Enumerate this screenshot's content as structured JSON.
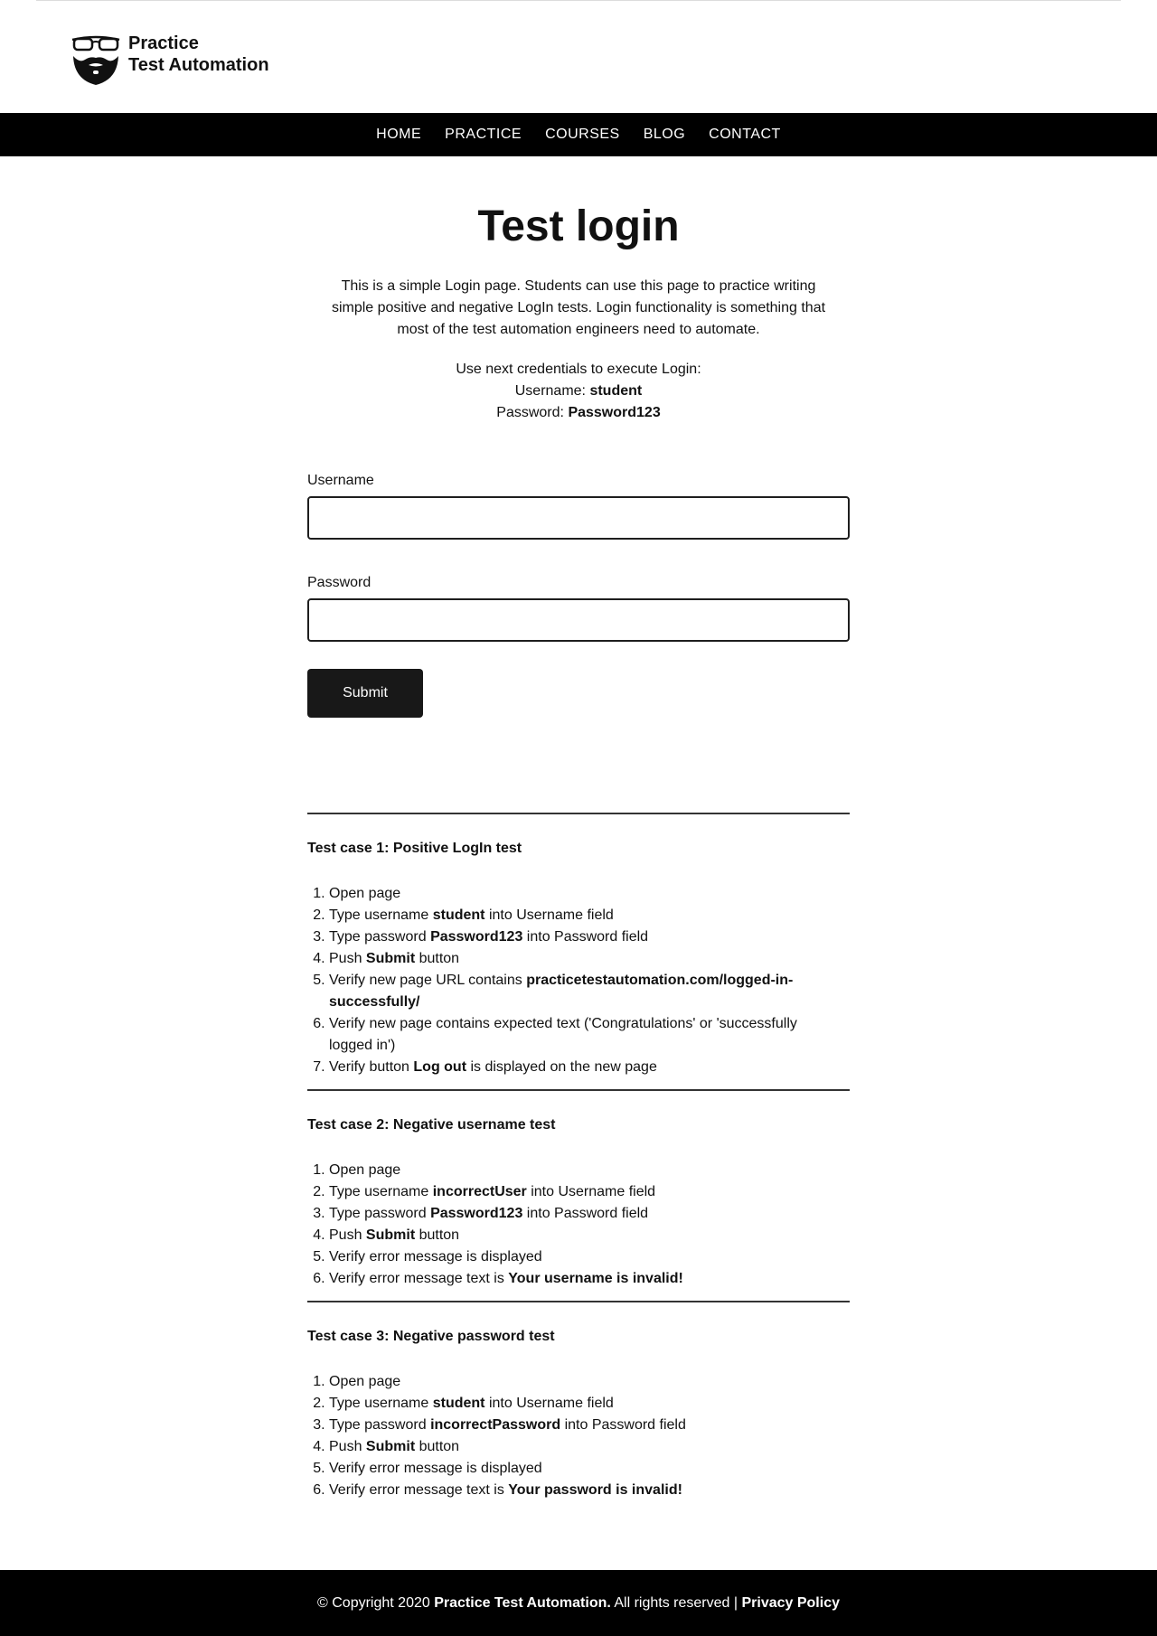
{
  "brand": {
    "line1": "Practice",
    "line2": "Test Automation",
    "icon": "bearded-glasses-face-icon"
  },
  "nav": {
    "home": "HOME",
    "practice": "PRACTICE",
    "courses": "COURSES",
    "blog": "BLOG",
    "contact": "CONTACT"
  },
  "page": {
    "title": "Test login",
    "intro": "This is a simple Login page. Students can use this page to practice writing simple positive and negative LogIn tests. Login functionality is something that most of the test automation engineers need to automate.",
    "creds_heading": "Use next credentials to execute Login:",
    "username_label": "Username:",
    "username_value": "student",
    "password_label": "Password:",
    "password_value": "Password123"
  },
  "form": {
    "username_label": "Username",
    "username_value": "",
    "password_label": "Password",
    "password_value": "",
    "submit_label": "Submit"
  },
  "test_cases": {
    "tc1": {
      "title": "Test case 1: Positive LogIn test",
      "s1": "Open page",
      "s2a": "Type username ",
      "s2b": "student",
      "s2c": " into Username field",
      "s3a": "Type password ",
      "s3b": "Password123",
      "s3c": " into Password field",
      "s4a": "Push ",
      "s4b": "Submit",
      "s4c": " button",
      "s5a": "Verify new page URL contains ",
      "s5b": "practicetestautomation.com/logged-in-successfully/",
      "s6": "Verify new page contains expected text ('Congratulations' or 'successfully logged in')",
      "s7a": "Verify button ",
      "s7b": "Log out",
      "s7c": " is displayed on the new page"
    },
    "tc2": {
      "title": "Test case 2: Negative username test",
      "s1": "Open page",
      "s2a": "Type username ",
      "s2b": "incorrectUser",
      "s2c": " into Username field",
      "s3a": "Type password ",
      "s3b": "Password123",
      "s3c": " into Password field",
      "s4a": "Push ",
      "s4b": "Submit",
      "s4c": " button",
      "s5": "Verify error message is displayed",
      "s6a": "Verify error message text is ",
      "s6b": "Your username is invalid!"
    },
    "tc3": {
      "title": "Test case 3: Negative password test",
      "s1": "Open page",
      "s2a": "Type username ",
      "s2b": "student",
      "s2c": " into Username field",
      "s3a": "Type password ",
      "s3b": "incorrectPassword",
      "s3c": " into Password field",
      "s4a": "Push ",
      "s4b": "Submit",
      "s4c": " button",
      "s5": "Verify error message is displayed",
      "s6a": "Verify error message text is ",
      "s6b": "Your password is invalid!"
    }
  },
  "footer": {
    "copyright": "© Copyright 2020 ",
    "brand": "Practice Test Automation.",
    "rights": " All rights reserved | ",
    "privacy": "Privacy Policy"
  }
}
